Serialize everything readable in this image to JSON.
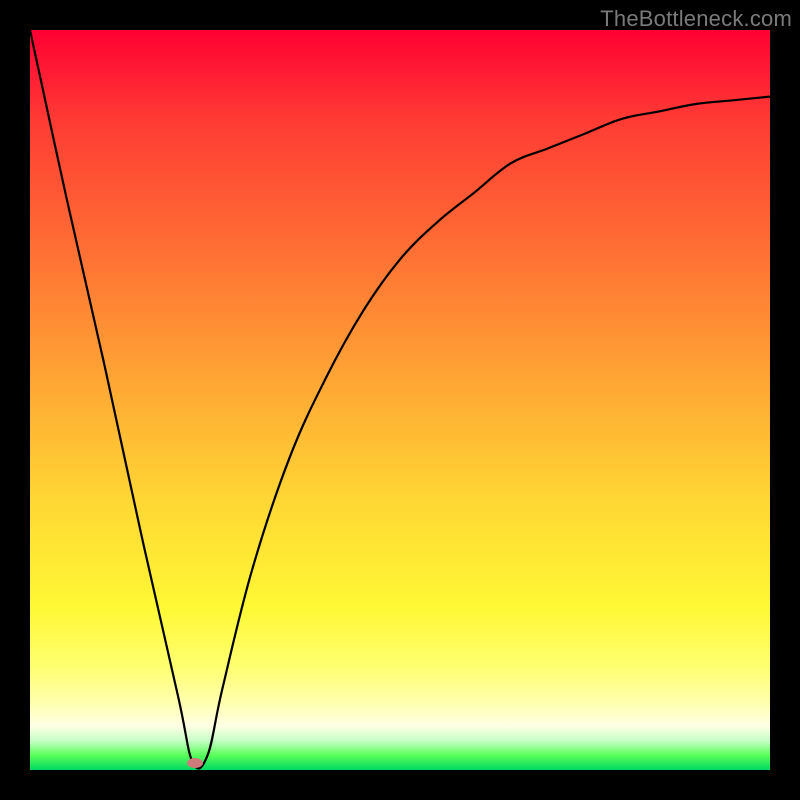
{
  "watermark": "TheBottleneck.com",
  "chart_data": {
    "type": "line",
    "title": "",
    "xlabel": "",
    "ylabel": "",
    "xlim": [
      0,
      100
    ],
    "ylim": [
      0,
      100
    ],
    "grid": false,
    "series": [
      {
        "name": "curve",
        "x": [
          0,
          5,
          10,
          15,
          20,
          22,
          24,
          26,
          30,
          35,
          40,
          45,
          50,
          55,
          60,
          65,
          70,
          75,
          80,
          85,
          90,
          95,
          100
        ],
        "y": [
          100,
          77,
          55,
          32,
          10,
          1,
          2,
          11,
          27,
          42,
          53,
          62,
          69,
          74,
          78,
          82,
          84,
          86,
          88,
          89,
          90,
          90.5,
          91
        ]
      }
    ],
    "marker": {
      "x": 22.3,
      "y": 1,
      "color": "#cf7b7b"
    },
    "background_gradient": {
      "top": "#ff0033",
      "mid": "#ffff70",
      "bottom": "#00d860"
    }
  }
}
